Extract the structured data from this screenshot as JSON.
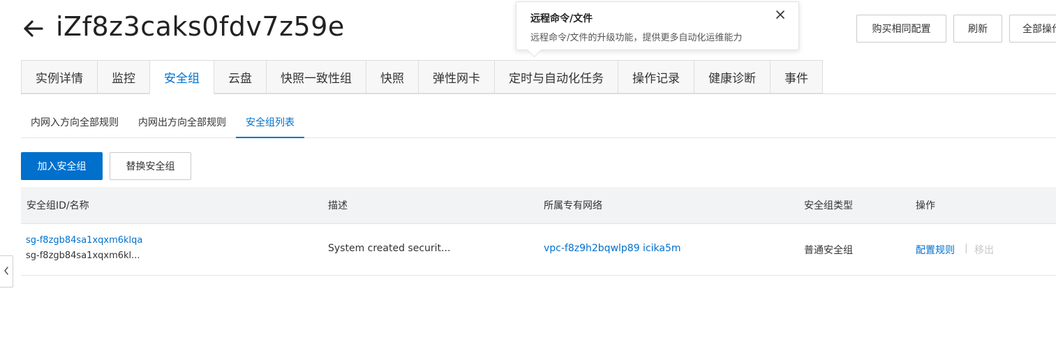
{
  "header": {
    "title": "iZf8z3caks0fdv7z59e",
    "back_icon": "arrow-left-icon"
  },
  "toolbar": {
    "buy_same_label": "购买相同配置",
    "refresh_label": "刷新",
    "all_actions_label": "全部操作"
  },
  "tooltip": {
    "title": "远程命令/文件",
    "body": "远程命令/文件的升级功能，提供更多自动化运维能力",
    "close_icon": "close-icon"
  },
  "main_tabs": [
    {
      "label": "实例详情"
    },
    {
      "label": "监控"
    },
    {
      "label": "安全组",
      "active": true
    },
    {
      "label": "云盘"
    },
    {
      "label": "快照一致性组"
    },
    {
      "label": "快照"
    },
    {
      "label": "弹性网卡"
    },
    {
      "label": "定时与自动化任务"
    },
    {
      "label": "操作记录"
    },
    {
      "label": "健康诊断"
    },
    {
      "label": "事件"
    }
  ],
  "sub_tabs": [
    {
      "label": "内网入方向全部规则"
    },
    {
      "label": "内网出方向全部规则"
    },
    {
      "label": "安全组列表",
      "active": true
    }
  ],
  "actions": {
    "join_label": "加入安全组",
    "replace_label": "替换安全组"
  },
  "table": {
    "columns": [
      "安全组ID/名称",
      "描述",
      "所属专有网络",
      "安全组类型",
      "操作"
    ],
    "rows": [
      {
        "id": "sg-f8zgb84sa1xqxm6klqa",
        "name": "sg-f8zgb84sa1xqxm6kl...",
        "description": "System created securit...",
        "vpc": "vpc-f8z9h2bqwlp89 icika5m",
        "type": "普通安全组",
        "action_config": "配置规则",
        "action_separator": "|",
        "action_remove": "移出"
      }
    ]
  },
  "side_handle_icon": "chevron-left-icon",
  "colors": {
    "accent": "#0070cc",
    "header_bg": "#f2f3f5",
    "tab_bg": "#f7f7f7",
    "border": "#dddddd"
  }
}
